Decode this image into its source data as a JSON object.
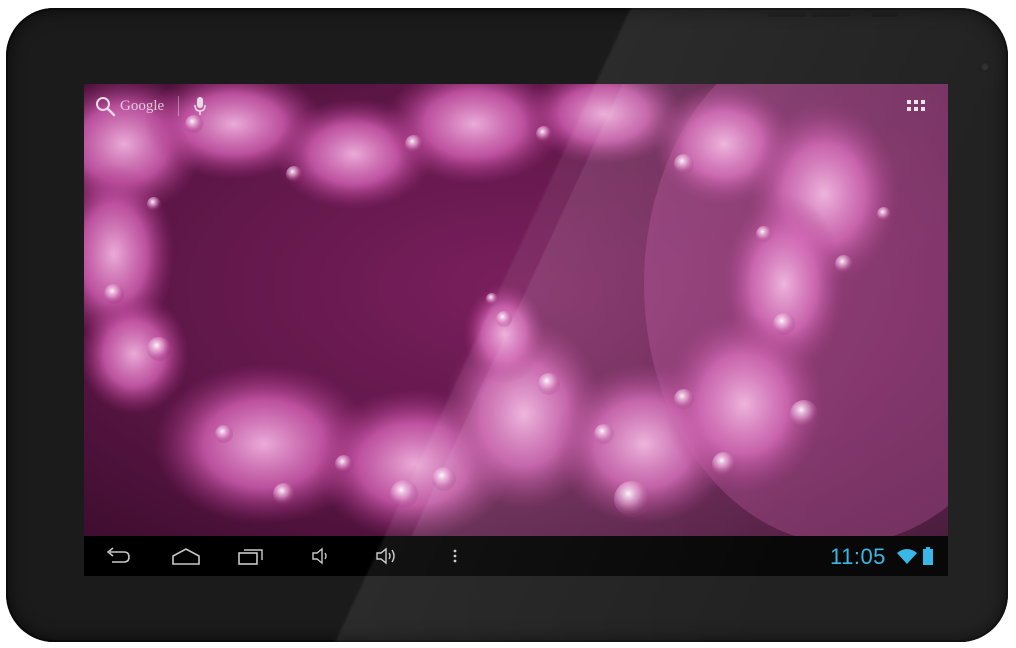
{
  "search": {
    "label": "Google"
  },
  "status": {
    "time": "11:05"
  },
  "icons": {
    "search": "search-icon",
    "mic": "microphone-icon",
    "apps": "app-drawer-icon",
    "back": "back-icon",
    "home": "home-icon",
    "recents": "recent-apps-icon",
    "vol_down": "volume-down-icon",
    "vol_up": "volume-up-icon",
    "menu": "menu-icon",
    "wifi": "wifi-icon",
    "battery": "battery-icon"
  },
  "colors": {
    "accent": "#33b5e5",
    "wallpaper": "#b0378f"
  }
}
